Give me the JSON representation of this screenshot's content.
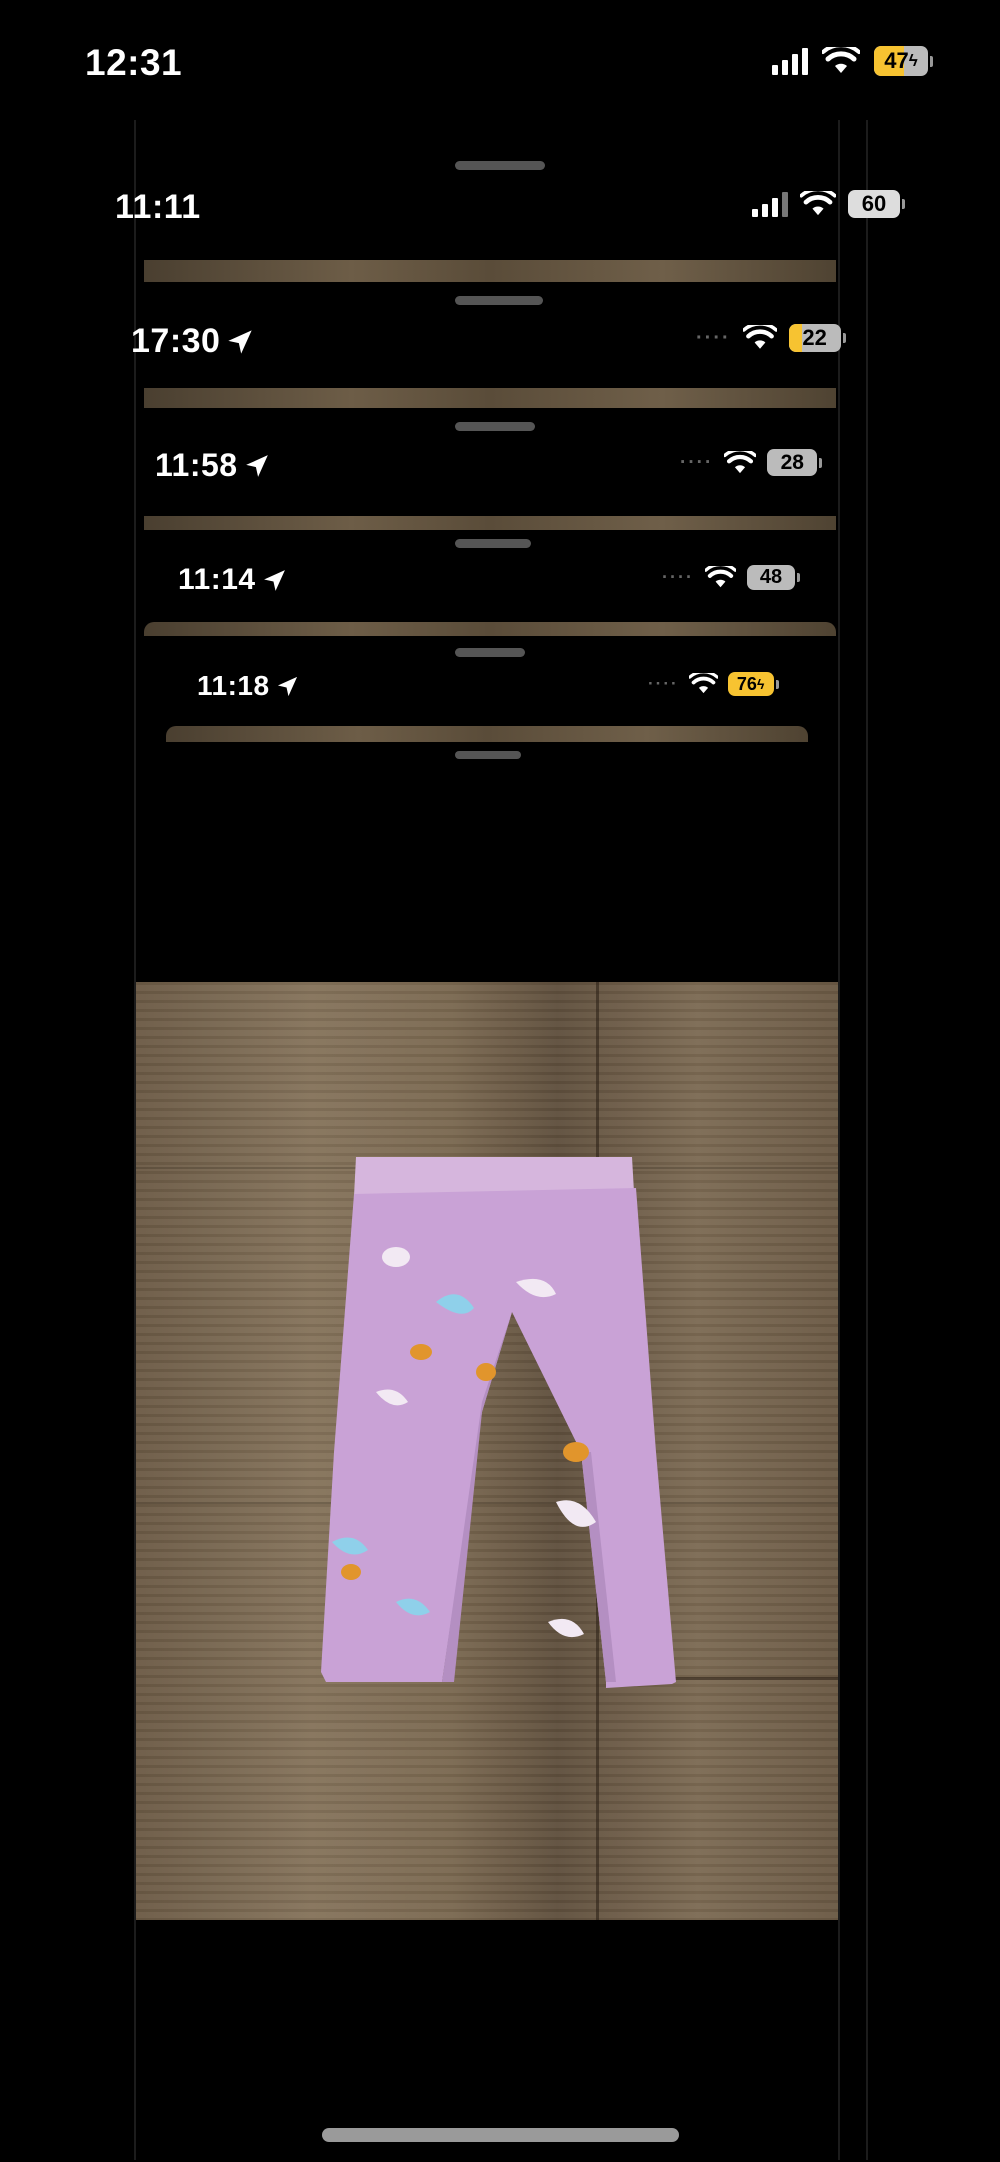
{
  "main_status": {
    "time": "12:31",
    "battery": "47",
    "battery_color": "#f7c331",
    "charging": true
  },
  "stacked_screens": [
    {
      "time": "11:11",
      "battery": "60",
      "location": false,
      "battery_color": "#cccccc"
    },
    {
      "time": "17:30",
      "battery": "22",
      "location": true,
      "battery_color": "#f7c331"
    },
    {
      "time": "11:58",
      "battery": "28",
      "location": true,
      "battery_color": "#cccccc"
    },
    {
      "time": "11:14",
      "battery": "48",
      "location": true,
      "battery_color": "#cccccc"
    },
    {
      "time": "11:18",
      "battery": "76",
      "location": true,
      "battery_color": "#f7c331",
      "charging": true
    }
  ],
  "location_icon": "location-arrow-icon",
  "photo": {
    "subject": "pink unicorn-print baby leggings on wooden floor"
  },
  "colors": {
    "background": "#000000",
    "grabber": "#555555",
    "home_indicator": "#9a9a9a"
  }
}
